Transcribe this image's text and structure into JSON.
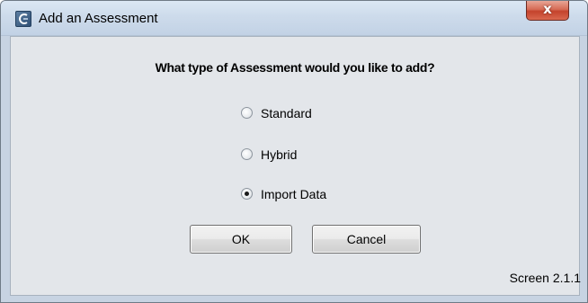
{
  "window": {
    "title": "Add an Assessment",
    "close_glyph": "x"
  },
  "dialog": {
    "question": "What type of Assessment would you like to add?",
    "options": [
      {
        "label": "Standard",
        "selected": false
      },
      {
        "label": "Hybrid",
        "selected": false
      },
      {
        "label": "Import Data",
        "selected": true
      }
    ],
    "ok_label": "OK",
    "cancel_label": "Cancel",
    "screen_id": "Screen 2.1.1"
  },
  "colors": {
    "titlebar": "#cddbeb",
    "client_bg": "#e3e6ea",
    "close_button": "#c4432c"
  },
  "icons": {
    "app": "app-logo-icon",
    "close": "close-icon"
  }
}
